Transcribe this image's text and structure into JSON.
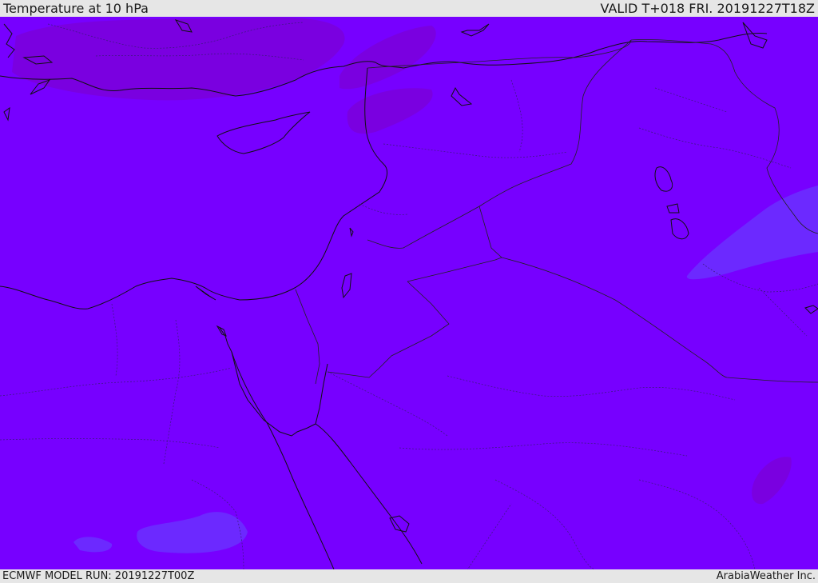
{
  "header": {
    "title": "Temperature at 10 hPa",
    "valid": "VALID T+018 FRI. 20191227T18Z"
  },
  "footer": {
    "model_run": "ECMWF MODEL RUN: 20191227T00Z",
    "credit": "ArabiaWeather Inc."
  },
  "colors": {
    "field_base": "#7700ff",
    "field_warm": "#7a00e0",
    "field_cool": "#6a28ff",
    "bar_bg": "#e6e6e6"
  }
}
